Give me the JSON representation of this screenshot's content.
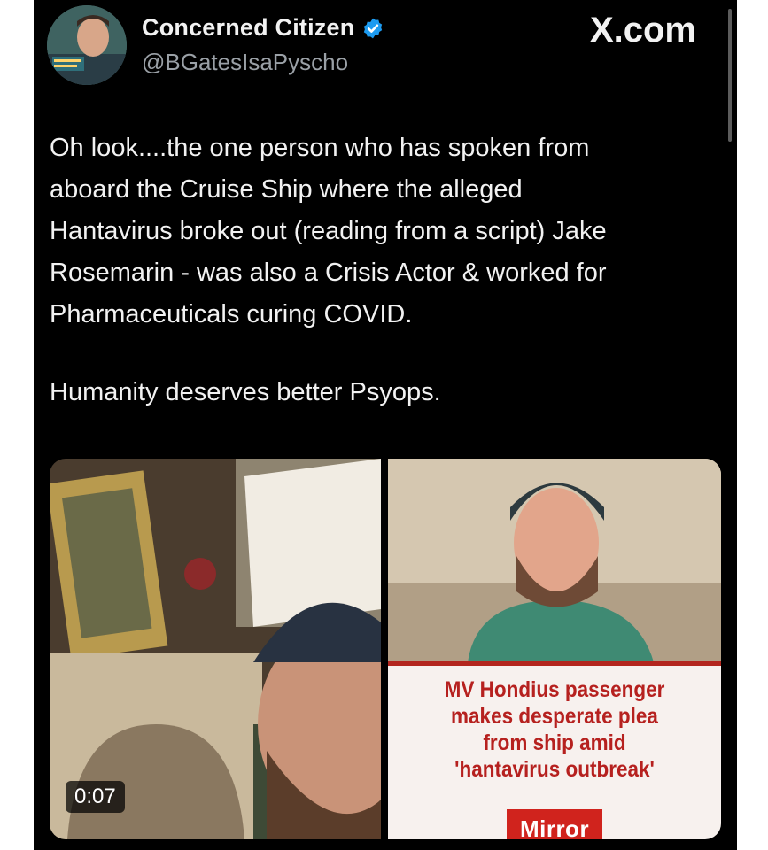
{
  "post": {
    "display_name": "Concerned Citizen",
    "handle": "@BGatesIsaPyscho",
    "site_label": "X.com",
    "text_lines": [
      "Oh look....the one person who has spoken from",
      "aboard the Cruise Ship where the alleged",
      "Hantavirus broke out (reading from a script) Jake",
      "Rosemarin - was also a Crisis Actor & worked for",
      "Pharmaceuticals curing COVID."
    ],
    "text_para2": "Humanity deserves better Psyops."
  },
  "media": {
    "video_duration": "0:07",
    "news_headline_lines": [
      "MV Hondius passenger",
      "makes desperate plea",
      "from ship amid",
      "'hantavirus outbreak'"
    ],
    "news_logo": "Mirror"
  },
  "colors": {
    "background": "#000000",
    "text": "#f2f2f2",
    "handle": "#9aa0a6",
    "verified": "#1d9bf0",
    "headline_red": "#b6211f",
    "mirror_red": "#d0231d"
  }
}
